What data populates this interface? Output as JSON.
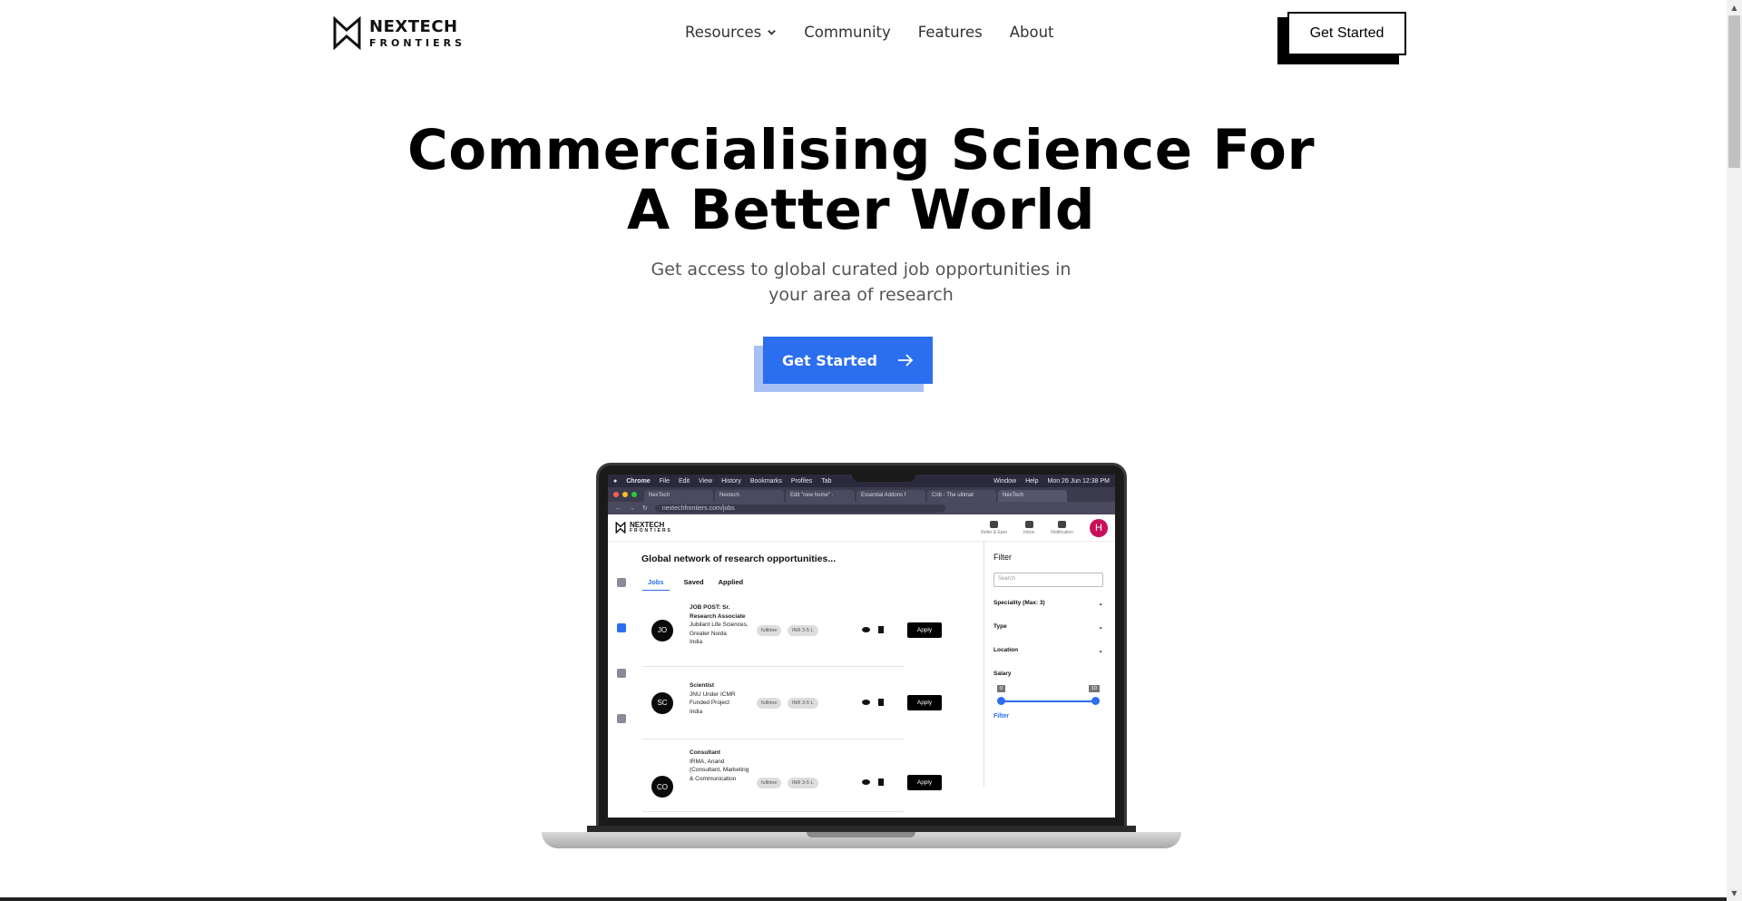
{
  "brand": {
    "line1": "NEXTECH",
    "line2": "FRONTIERS"
  },
  "nav": {
    "items": [
      {
        "label": "Resources",
        "has_dropdown": true
      },
      {
        "label": "Community"
      },
      {
        "label": "Features"
      },
      {
        "label": "About"
      }
    ],
    "cta_label": "Get Started"
  },
  "hero": {
    "title_line1": "Commercialising Science For",
    "title_line2": "A Better World",
    "subtitle": "Get access to global curated job opportunities in your area of research",
    "cta_label": "Get Started",
    "cta_color": "#2b6ef0"
  },
  "mockup": {
    "menu": {
      "apple": "",
      "app": "Chrome",
      "items": [
        "File",
        "Edit",
        "View",
        "History",
        "Bookmarks",
        "Profiles",
        "Tab"
      ],
      "right": [
        "Window",
        "Help"
      ],
      "clock": "Mon 26 Jun  12:38 PM"
    },
    "tabs": [
      "NexTech",
      "Nextech",
      "Edit \"new home\" ·",
      "Essential Addons f",
      "Crib - The ultimat",
      "NexTech"
    ],
    "url": "nextechfrontiers.com/jobs",
    "app_logo": {
      "line1": "NEXTECH",
      "line2": "FRONTIERS"
    },
    "header_icons": [
      "Refer & Earn",
      "Inbox",
      "Notification"
    ],
    "avatar_initial": "H",
    "heading": "Global network of research opportunities...",
    "tabs_app": [
      "Jobs",
      "Saved",
      "Applied"
    ],
    "jobs": [
      {
        "initials": "JO",
        "title": "JOB POST: Sr. Research Associate",
        "org": "Jubilant Life Sciences, Greater Noida",
        "country": "India",
        "type": "fulltime",
        "salary": "INR 3-5 L",
        "apply": "Apply"
      },
      {
        "initials": "SC",
        "title": "Scientist",
        "org": "JNU Under ICMR Funded Project",
        "country": "India",
        "type": "fulltime",
        "salary": "INR 3-5 L",
        "apply": "Apply"
      },
      {
        "initials": "CO",
        "title": "Consultant",
        "org": "IRMA, Anand (Consultant, Marketing & Communication",
        "country": "",
        "type": "fulltime",
        "salary": "INR 3-5 L",
        "apply": "Apply"
      }
    ],
    "filter": {
      "title": "Filter",
      "search_placeholder": "Search",
      "groups": [
        "Speciality (Max: 3)",
        "Type",
        "Location"
      ],
      "salary_label": "Salary",
      "salary_min": "0",
      "salary_max": "10",
      "link": "Filter"
    }
  }
}
